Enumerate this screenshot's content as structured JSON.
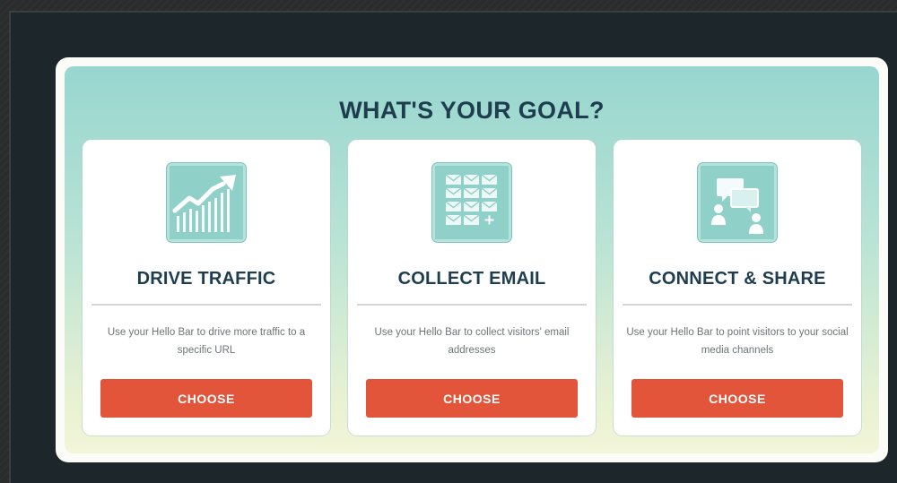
{
  "heading": "WHAT'S YOUR GOAL?",
  "colors": {
    "heading_text": "#1e3d4f",
    "button": "#e2553a",
    "icon_tile": "#8fd0c8",
    "panel_gradient_top": "#97d6cf",
    "panel_gradient_bottom": "#f3f5d8"
  },
  "goals": [
    {
      "icon": "traffic-chart-icon",
      "title": "DRIVE TRAFFIC",
      "description": "Use your Hello Bar to drive more traffic to a specific URL",
      "button_label": "CHOOSE"
    },
    {
      "icon": "email-grid-icon",
      "title": "COLLECT EMAIL",
      "description": "Use your Hello Bar to collect visitors' email addresses",
      "button_label": "CHOOSE"
    },
    {
      "icon": "social-chat-icon",
      "title": "CONNECT & SHARE",
      "description": "Use your Hello Bar to point visitors to your social media channels",
      "button_label": "CHOOSE"
    }
  ]
}
